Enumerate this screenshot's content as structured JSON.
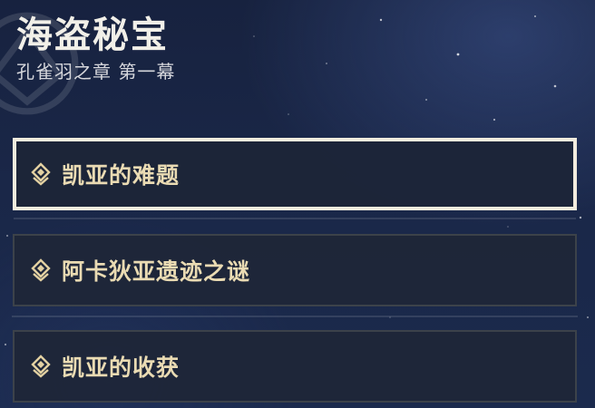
{
  "header": {
    "title": "海盗秘宝",
    "subtitle": "孔雀羽之章 第一幕"
  },
  "quests": [
    {
      "label": "凯亚的难题",
      "selected": true
    },
    {
      "label": "阿卡狄亚遗迹之谜",
      "selected": false
    },
    {
      "label": "凯亚的收获",
      "selected": false
    }
  ],
  "colors": {
    "background": "#1a2748",
    "accent_gold": "#eadbb3",
    "selection_border": "#f2ecde"
  },
  "icons": {
    "quest_marker": "quest-diamond-icon"
  }
}
